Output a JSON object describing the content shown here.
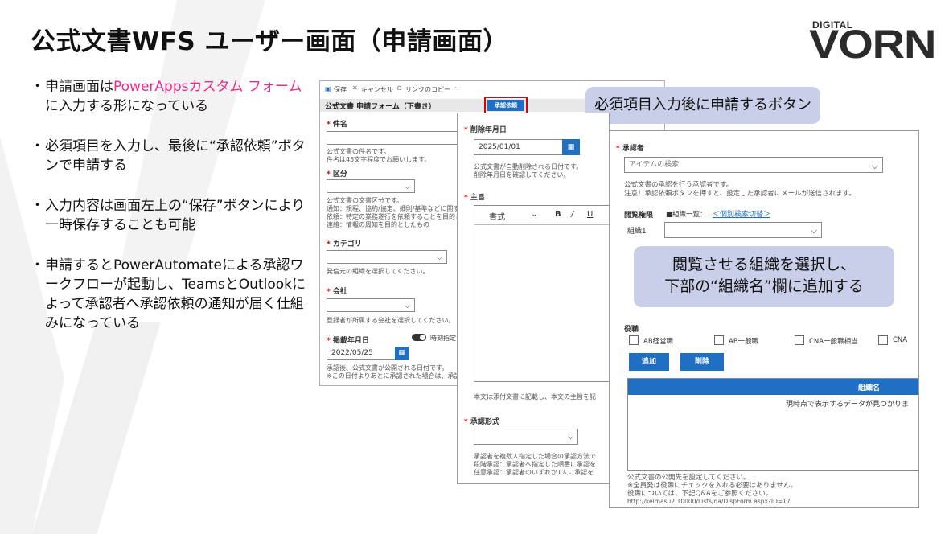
{
  "slide": {
    "title": "公式文書WFS ユーザー画面（申請画面）",
    "logo_small": "DIGITAL",
    "logo_big": "VORN"
  },
  "bullets": {
    "b1_a": "申請画面は",
    "b1_pink": "PowerAppsカスタム フォーム",
    "b1_b": "に入力する形になっている",
    "b2": "必須項目を入力し、最後に“承認依頼”ボタンで申請する",
    "b3": "入力内容は画面左上の“保存”ボタンにより一時保存することも可能",
    "b4": "申請するとPowerAutomateによる承認ワークフローが起動し、TeamsとOutlookによって承認者へ承認依頼の通知が届く仕組みになっている"
  },
  "form1": {
    "toolbar_save": "保存",
    "toolbar_cancel": "キャンセル",
    "toolbar_copy_link": "リンクのコピー",
    "toolbar_more": "···",
    "form_title": "公式文書 申請フォーム（下書き）",
    "approve_button": "承認依頼",
    "subject_label": "件名",
    "subject_hint": "公式文書の件名です。\n件名は45文字程度でお願いします。",
    "category_label": "区分",
    "category_hint": "公式文書の文書区分です。\n通知：規程、協約/協定、細則/基準などに関する通知\n依頼：特定の業務遂行を依頼することを目的とした\n連絡：情報の周知を目的としたもの",
    "cat2_label": "カテゴリ",
    "cat2_hint": "発信元の組織を選択してください。",
    "company_label": "会社",
    "company_hint": "登録者が所属する会社を選択してください。",
    "pubdate_label": "掲載年月日",
    "toggle_label": "時刻指定な",
    "pubdate_value": "2022/05/25",
    "pubdate_hint": "承認後、公式文書が公開される日付です。\n※この日付よりあとに承認された場合は、承認日に"
  },
  "form2": {
    "deldate_label": "削除年月日",
    "deldate_value": "2025/01/01",
    "deldate_hint": "公式文書が自動削除される日付です。\n削除年月日を確認してください。",
    "body_label": "主旨",
    "rt_format": "書式",
    "rt_bold": "B",
    "rt_italic": "/",
    "rt_underline": "U",
    "body_hint": "本文は添付文書に記載し、本文の主旨を記",
    "approval_type_label": "承認形式",
    "approval_type_hint": "承認者を複数人指定した場合の承認方法で\n段階承認：承認者へ指定した順番に承認を\n任意承認：承認者のいずれか1人に承認を"
  },
  "form3": {
    "approver_label": "承認者",
    "approver_placeholder": "アイテムの検索",
    "approver_hint": "公式文書の承認を行う承認者です。\n注意！承認依頼ボタンを押すと、設定した承認者にメールが送信されます。",
    "access_label": "閲覧権限",
    "org_list_label": "■組織一覧：",
    "org_switch_link": "＜個別検索切替＞",
    "org1_label": "組織1",
    "role_label": "役職",
    "role_options": [
      "AB経営職",
      "AB一般職",
      "CNA一般職相当",
      "CNA"
    ],
    "add_button": "追加",
    "delete_button": "削除",
    "table_header": "組織名",
    "table_empty": "現時点で表示するデータが見つかりま",
    "footer_hint": "公式文書の公開先を設定してください。\n※全員発は役職にチェックを入れる必要はありません。\n役職については、下記Q&Aをご参照ください。",
    "footer_url": "http://keimasu2:10000/Lists/qa/DispForm.aspx?ID=17"
  },
  "callouts": {
    "c1": "必須項目入力後に申請するボタン",
    "c2_line1": "閲覧させる組織を選択し、",
    "c2_line2": "下部の“組織名”欄に追加する"
  },
  "colors": {
    "accent_blue": "#1f6fc4",
    "callout_bg": "#c9cfe8",
    "pink": "#ee2a8a",
    "highlight_red": "#e00000"
  }
}
